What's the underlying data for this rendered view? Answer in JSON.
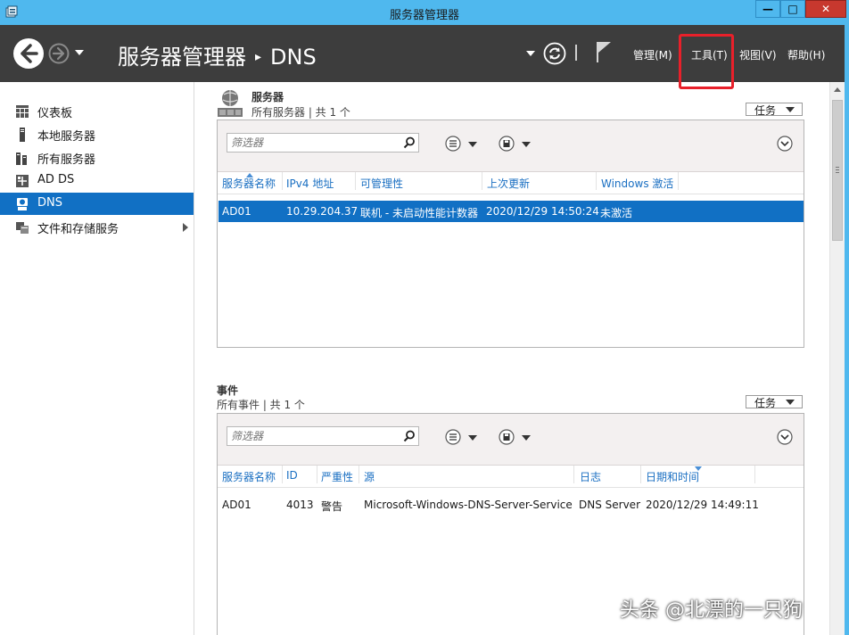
{
  "window": {
    "title": "服务器管理器",
    "min_glyph": "—",
    "max_glyph": "□",
    "close_glyph": "✕"
  },
  "header": {
    "breadcrumb_root": "服务器管理器",
    "breadcrumb_sep": "▸",
    "breadcrumb_current": "DNS",
    "menus": {
      "manage": "管理(M)",
      "tools": "工具(T)",
      "view": "视图(V)",
      "help": "帮助(H)"
    }
  },
  "sidebar": {
    "items": [
      {
        "label": "仪表板",
        "icon": "dashboard-icon"
      },
      {
        "label": "本地服务器",
        "icon": "server-icon"
      },
      {
        "label": "所有服务器",
        "icon": "servers-icon"
      },
      {
        "label": "AD DS",
        "icon": "ad-ds-icon"
      },
      {
        "label": "DNS",
        "icon": "dns-icon",
        "selected": true
      },
      {
        "label": "文件和存储服务",
        "icon": "file-storage-icon",
        "expandable": true
      }
    ]
  },
  "servers": {
    "title": "服务器",
    "subtitle": "所有服务器 | 共 1 个",
    "tasks": "任务",
    "filter_placeholder": "筛选器",
    "columns": [
      "服务器名称",
      "IPv4 地址",
      "可管理性",
      "上次更新",
      "Windows 激活"
    ],
    "rows": [
      [
        "AD01",
        "10.29.204.37",
        "联机 - 未启动性能计数器",
        "2020/12/29 14:50:24",
        "未激活"
      ]
    ]
  },
  "events": {
    "title": "事件",
    "subtitle": "所有事件 | 共 1 个",
    "tasks": "任务",
    "filter_placeholder": "筛选器",
    "columns": [
      "服务器名称",
      "ID",
      "严重性",
      "源",
      "日志",
      "日期和时间"
    ],
    "rows": [
      [
        "AD01",
        "4013",
        "警告",
        "Microsoft-Windows-DNS-Server-Service",
        "DNS Server",
        "2020/12/29 14:49:11"
      ]
    ]
  },
  "watermark": "头条 @北漂的一只狗",
  "colors": {
    "titlebar": "#4fb8ee",
    "header": "#3d3d3d",
    "selection": "#1170c4",
    "column_text": "#1a6fc2",
    "highlight": "#e8202a"
  }
}
